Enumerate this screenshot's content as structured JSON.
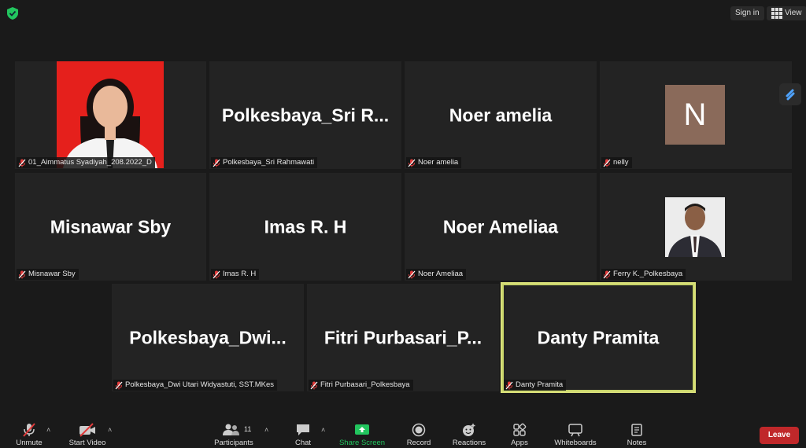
{
  "header": {
    "signin_label": "Sign in",
    "view_label": "View"
  },
  "tiles": [
    {
      "display": "",
      "label": "01_Aimmatus Syadiyah_208.2022_D",
      "kind": "photo-red"
    },
    {
      "display": "Polkesbaya_Sri  R...",
      "label": "Polkesbaya_Sri Rahmawati",
      "kind": "name"
    },
    {
      "display": "Noer amelia",
      "label": "Noer amelia",
      "kind": "name"
    },
    {
      "display": "N",
      "label": "nelly",
      "kind": "avatar"
    },
    {
      "display": "Misnawar Sby",
      "label": "Misnawar Sby",
      "kind": "name"
    },
    {
      "display": "Imas R. H",
      "label": "Imas R. H",
      "kind": "name"
    },
    {
      "display": "Noer Ameliaa",
      "label": "Noer Ameliaa",
      "kind": "name"
    },
    {
      "display": "",
      "label": "Ferry K._Polkesbaya",
      "kind": "photo-man"
    },
    {
      "display": "Polkesbaya_Dwi...",
      "label": "Polkesbaya_Dwi Utari Widyastuti, SST.MKes",
      "kind": "name"
    },
    {
      "display": "Fitri  Purbasari_P...",
      "label": "Fitri Purbasari_Polkesbaya",
      "kind": "name"
    },
    {
      "display": "Danty Pramita",
      "label": "Danty Pramita",
      "kind": "name",
      "active": true
    }
  ],
  "toolbar": {
    "unmute": "Unmute",
    "start_video": "Start Video",
    "participants": "Participants",
    "participants_count": "11",
    "chat": "Chat",
    "share_screen": "Share Screen",
    "record": "Record",
    "reactions": "Reactions",
    "apps": "Apps",
    "whiteboards": "Whiteboards",
    "notes": "Notes",
    "leave": "Leave"
  },
  "colors": {
    "share_green": "#22c55e",
    "leave_red": "#c0282a",
    "active_border": "#d9e07a",
    "mute_red": "#e03b3b"
  }
}
